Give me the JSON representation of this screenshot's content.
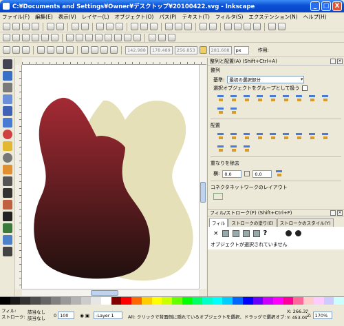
{
  "window": {
    "title": "C:¥Documents and Settings¥Owner¥デスクトップ¥20100422.svg - Inkscape",
    "buttons": [
      "_",
      "□",
      "X"
    ]
  },
  "menu": [
    "ファイル(F)",
    "編集(E)",
    "表示(V)",
    "レイヤー(L)",
    "オブジェクト(O)",
    "パス(P)",
    "テキスト(T)",
    "フィルタ(S)",
    "エクステンション(N)",
    "ヘルプ(H)"
  ],
  "controls": {
    "x": "142.988",
    "y": "178.489",
    "w": "256.853",
    "h": "281.608",
    "unit": "px",
    "label": "作用:"
  },
  "align_panel": {
    "title": "整列と配置(A) (Shift+Ctrl+A)",
    "section_align": "整列",
    "relative_label": "基準:",
    "relative_value": "最初の選択部分",
    "group_check": "選択オブジェクトをグループとして扱う",
    "section_distribute": "配置",
    "section_overlap": "重なりを除去",
    "h_label": "横:",
    "h_value": "0.0",
    "v_value": "0.0",
    "section_network": "コネクタネットワークのレイアウト"
  },
  "fill_panel": {
    "title": "フィル/ストローク(F) (Shift+Ctrl+F)",
    "tab_fill": "フィル",
    "tab_stroke_paint": "ストロークの塗り(E)",
    "tab_stroke_style": "ストロークのスタイル(Y)",
    "message": "オブジェクトが選択されていません",
    "unset_icon": "?"
  },
  "palette": [
    "#000000",
    "#1a1a1a",
    "#333333",
    "#4d4d4d",
    "#666666",
    "#808080",
    "#999999",
    "#b3b3b3",
    "#cccccc",
    "#e6e6e6",
    "#ffffff",
    "#800000",
    "#ff0000",
    "#ff6600",
    "#ffcc00",
    "#ffff00",
    "#ccff00",
    "#66ff00",
    "#00ff00",
    "#00ff66",
    "#00ffcc",
    "#00ffff",
    "#00ccff",
    "#0066ff",
    "#0000ff",
    "#6600ff",
    "#cc00ff",
    "#ff00ff",
    "#ff0099",
    "#ff6699",
    "#ffcccc",
    "#ffccff",
    "#ccccff",
    "#ccffff"
  ],
  "status": {
    "fill_label": "フィル:",
    "stroke_label": "ストローク:",
    "fill_value": "該当なし",
    "stroke_value": "該当なし",
    "opacity": "0",
    "opacity_value": "100",
    "layer": "-Layer 1",
    "message": "Alt: クリックで背面側に隠れているオブジェクトを選択、ドラッグで選択オブジェクト",
    "x_label": "X:",
    "x": "266.32",
    "y_label": "Y:",
    "y": "453.09",
    "zoom_label": "Z:",
    "zoom": "170%"
  },
  "colors": {
    "guitar_front_top": "#a42a34",
    "guitar_front_bottom": "#20100e",
    "guitar_back": "#e6e0b8"
  }
}
